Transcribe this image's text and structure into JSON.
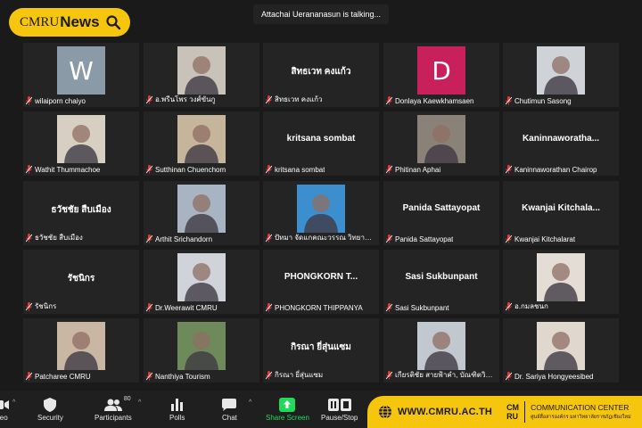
{
  "talking_banner": "Attachai Uerananasun is talking...",
  "brand": {
    "part1": "CMRU",
    "part2": "News"
  },
  "tiles": [
    {
      "type": "letter",
      "letter": "W",
      "bg": "#8a9aa7",
      "label": "wilaiporn chaiyo"
    },
    {
      "type": "photo",
      "bg": "#c9c2b8",
      "label": "อ.พรีนโพร วงศ์ขันกู"
    },
    {
      "type": "name",
      "name": "สิทธเวท คงแก้ว",
      "label": "สิทธเวท คงแก้ว"
    },
    {
      "type": "letter",
      "letter": "D",
      "bg": "#c8205a",
      "label": "Donlaya Kaewkhamsaen"
    },
    {
      "type": "photo",
      "bg": "#cfd3d8",
      "label": "Chutimun Sasong"
    },
    {
      "type": "photo",
      "bg": "#d7d0c2",
      "label": "Wathit Thummachoe"
    },
    {
      "type": "photo",
      "bg": "#c5b59a",
      "label": "Sutthinan Chuenchom"
    },
    {
      "type": "name",
      "name": "kritsana sombat",
      "label": "kritsana sombat"
    },
    {
      "type": "photo",
      "bg": "#8a8278",
      "label": "Phitinan Aphai"
    },
    {
      "type": "name",
      "name": "Kaninnaworatha...",
      "label": "Kaninnaworathan Chairop"
    },
    {
      "type": "name",
      "name": "ธวัชชัย สืบเมือง",
      "label": "ธวัชชัย สืบเมือง"
    },
    {
      "type": "photo",
      "bg": "#a9b4c2",
      "label": "Arthit Srichandorn"
    },
    {
      "type": "photo",
      "bg": "#3c8fcf",
      "label": "ปัทมา จัดแกคณะวรรณ วิทยาลัยน..."
    },
    {
      "type": "name",
      "name": "Panida Sattayopat",
      "label": "Panida Sattayopat"
    },
    {
      "type": "name",
      "name": "Kwanjai  Kitchala...",
      "label": "Kwanjai Kitchalarat"
    },
    {
      "type": "name",
      "name": "รัชนิกร",
      "label": "รัชนิกร"
    },
    {
      "type": "photo",
      "bg": "#d0d4da",
      "label": "Dr.Weerawit CMRU"
    },
    {
      "type": "name",
      "name": "PHONGKORN  T...",
      "label": "PHONGKORN THIPPANYA"
    },
    {
      "type": "name",
      "name": "Sasi Sukbunpant",
      "label": "Sasi Sukbunpant"
    },
    {
      "type": "photo",
      "bg": "#e4ddd6",
      "label": "อ.กมลชนก"
    },
    {
      "type": "photo",
      "bg": "#c9b7a4",
      "label": "Patcharee CMRU"
    },
    {
      "type": "photo",
      "bg": "#6f8a5a",
      "label": "Nanthiya Tourism"
    },
    {
      "type": "name",
      "name": "กิรณา ยี่สุ่นแซม",
      "label": "กิรณา ยี่สุ่นแซม"
    },
    {
      "type": "photo",
      "bg": "#c2c8cf",
      "label": "เกียรติชัย สายฟ้าคำ, บัณฑิตวิทย..."
    },
    {
      "type": "photo",
      "bg": "#e0d7cf",
      "label": "Dr. Sariya Hongyeesibed"
    }
  ],
  "toolbar": {
    "items": [
      {
        "label": "deo",
        "icon": "video-icon"
      },
      {
        "label": "Security",
        "icon": "shield-icon"
      },
      {
        "label": "Participants",
        "icon": "participants-icon",
        "count": "80"
      },
      {
        "label": "Polls",
        "icon": "polls-icon"
      },
      {
        "label": "Chat",
        "icon": "chat-icon"
      },
      {
        "label": "Share Screen",
        "icon": "share-screen-icon"
      },
      {
        "label": "Pause/Stop",
        "icon": "pause-icon"
      }
    ],
    "share_color": "#23d959"
  },
  "footer": {
    "url": "WWW.CMRU.AC.TH",
    "logo_line1": "CM",
    "logo_line2": "RU",
    "center_title": "COMMUNICATION CENTER",
    "center_sub": "ศูนย์สื่อสารองค์กร มหาวิทยาลัยราชภัฏเชียงใหม่"
  }
}
